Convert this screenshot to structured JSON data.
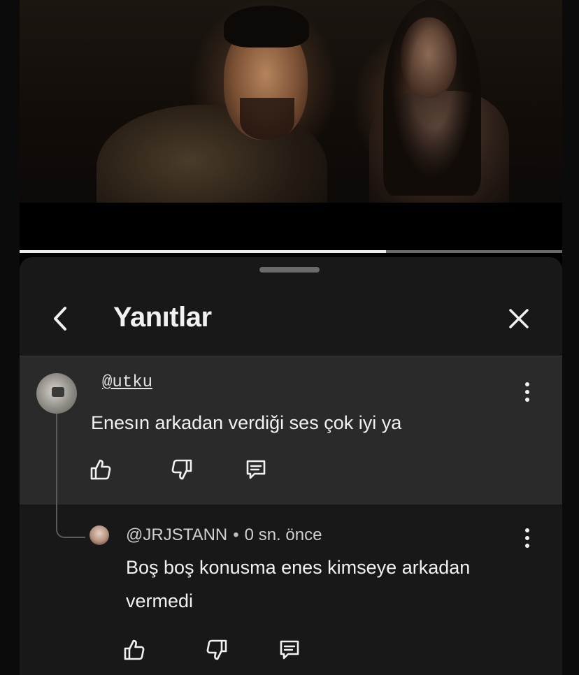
{
  "video": {
    "progress_fraction": 0.675,
    "colors": {
      "played": "#ececec",
      "remaining": "#6b6b6b"
    }
  },
  "panel": {
    "title": "Yanıtlar",
    "icons": {
      "back": "chevron-left-icon",
      "close": "close-icon",
      "more": "more-vertical-icon"
    }
  },
  "comments": [
    {
      "author": "@utku",
      "text": "Enesın arkadan verdiği ses çok iyi ya",
      "actions": [
        "thumbs-up-icon",
        "thumbs-down-icon",
        "reply-icon"
      ]
    },
    {
      "author": "@JRJSTANN",
      "separator": "•",
      "time": "0 sn. önce",
      "text": "Boş boş konusma enes kimseye arkadan vermedi",
      "actions": [
        "thumbs-up-icon",
        "thumbs-down-icon",
        "reply-icon"
      ]
    }
  ],
  "colors": {
    "background": "#000000",
    "panel": "#181818",
    "highlight": "#2a2a2a",
    "text": "#f1f1f1"
  }
}
